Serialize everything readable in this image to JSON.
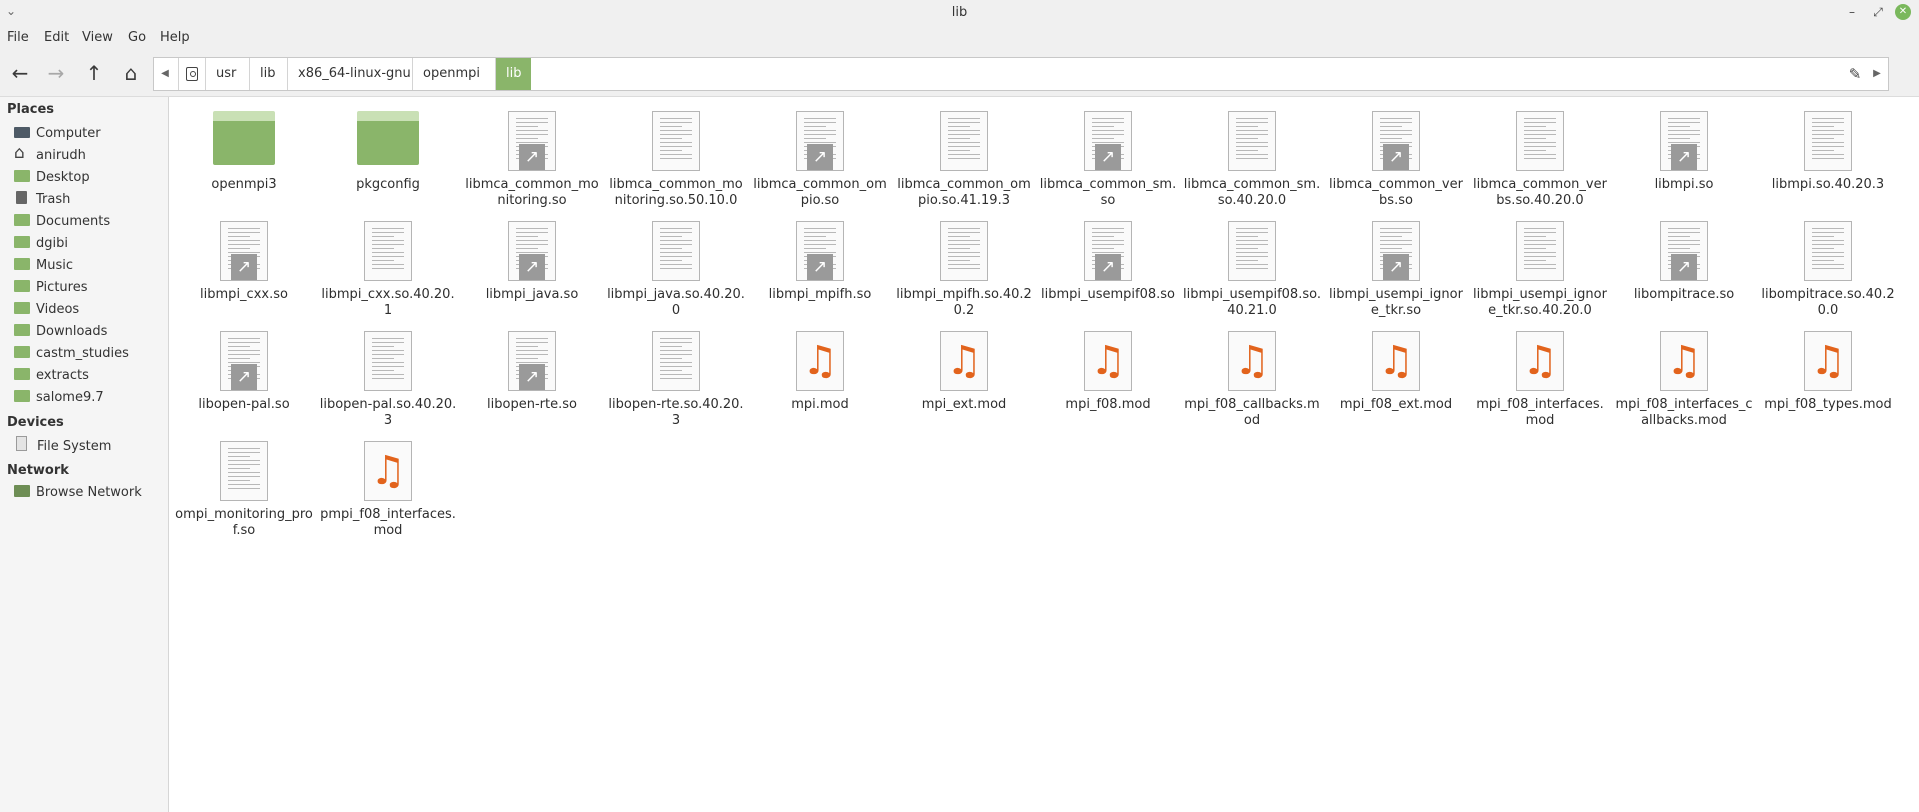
{
  "window": {
    "title": "lib"
  },
  "menu": [
    "File",
    "Edit",
    "View",
    "Go",
    "Help"
  ],
  "path": [
    "usr",
    "lib",
    "x86_64-linux-gnu",
    "openmpi",
    "lib"
  ],
  "sidebar": {
    "places_label": "Places",
    "places": [
      {
        "label": "Computer",
        "icon": "computer-icon"
      },
      {
        "label": "anirudh",
        "icon": "home-icon"
      },
      {
        "label": "Desktop",
        "icon": "folder-icon"
      },
      {
        "label": "Trash",
        "icon": "trash-icon"
      },
      {
        "label": "Documents",
        "icon": "folder-icon"
      },
      {
        "label": "dgibi",
        "icon": "folder-icon"
      },
      {
        "label": "Music",
        "icon": "folder-icon"
      },
      {
        "label": "Pictures",
        "icon": "folder-icon"
      },
      {
        "label": "Videos",
        "icon": "folder-icon"
      },
      {
        "label": "Downloads",
        "icon": "folder-icon"
      },
      {
        "label": "castm_studies",
        "icon": "folder-icon"
      },
      {
        "label": "extracts",
        "icon": "folder-icon"
      },
      {
        "label": "salome9.7",
        "icon": "folder-icon"
      }
    ],
    "devices_label": "Devices",
    "devices": [
      {
        "label": "File System",
        "icon": "drive-icon"
      }
    ],
    "network_label": "Network",
    "network": [
      {
        "label": "Browse Network",
        "icon": "network-icon"
      }
    ]
  },
  "files": [
    {
      "name": "openmpi3",
      "type": "folder"
    },
    {
      "name": "pkgconfig",
      "type": "folder"
    },
    {
      "name": "libmca_common_monitoring.so",
      "type": "doc",
      "link": true
    },
    {
      "name": "libmca_common_monitoring.so.50.10.0",
      "type": "doc",
      "link": false
    },
    {
      "name": "libmca_common_ompio.so",
      "type": "doc",
      "link": true
    },
    {
      "name": "libmca_common_ompio.so.41.19.3",
      "type": "doc",
      "link": false
    },
    {
      "name": "libmca_common_sm.so",
      "type": "doc",
      "link": true
    },
    {
      "name": "libmca_common_sm.so.40.20.0",
      "type": "doc",
      "link": false
    },
    {
      "name": "libmca_common_verbs.so",
      "type": "doc",
      "link": true
    },
    {
      "name": "libmca_common_verbs.so.40.20.0",
      "type": "doc",
      "link": false
    },
    {
      "name": "libmpi.so",
      "type": "doc",
      "link": true
    },
    {
      "name": "libmpi.so.40.20.3",
      "type": "doc",
      "link": false
    },
    {
      "name": "libmpi_cxx.so",
      "type": "doc",
      "link": true
    },
    {
      "name": "libmpi_cxx.so.40.20.1",
      "type": "doc",
      "link": false
    },
    {
      "name": "libmpi_java.so",
      "type": "doc",
      "link": true
    },
    {
      "name": "libmpi_java.so.40.20.0",
      "type": "doc",
      "link": false
    },
    {
      "name": "libmpi_mpifh.so",
      "type": "doc",
      "link": true
    },
    {
      "name": "libmpi_mpifh.so.40.20.2",
      "type": "doc",
      "link": false
    },
    {
      "name": "libmpi_usempif08.so",
      "type": "doc",
      "link": true
    },
    {
      "name": "libmpi_usempif08.so.40.21.0",
      "type": "doc",
      "link": false
    },
    {
      "name": "libmpi_usempi_ignore_tkr.so",
      "type": "doc",
      "link": true
    },
    {
      "name": "libmpi_usempi_ignore_tkr.so.40.20.0",
      "type": "doc",
      "link": false
    },
    {
      "name": "libompitrace.so",
      "type": "doc",
      "link": true
    },
    {
      "name": "libompitrace.so.40.20.0",
      "type": "doc",
      "link": false
    },
    {
      "name": "libopen-pal.so",
      "type": "doc",
      "link": true
    },
    {
      "name": "libopen-pal.so.40.20.3",
      "type": "doc",
      "link": false
    },
    {
      "name": "libopen-rte.so",
      "type": "doc",
      "link": true
    },
    {
      "name": "libopen-rte.so.40.20.3",
      "type": "doc",
      "link": false
    },
    {
      "name": "mpi.mod",
      "type": "music"
    },
    {
      "name": "mpi_ext.mod",
      "type": "music"
    },
    {
      "name": "mpi_f08.mod",
      "type": "music"
    },
    {
      "name": "mpi_f08_callbacks.mod",
      "type": "music"
    },
    {
      "name": "mpi_f08_ext.mod",
      "type": "music"
    },
    {
      "name": "mpi_f08_interfaces.mod",
      "type": "music"
    },
    {
      "name": "mpi_f08_interfaces_callbacks.mod",
      "type": "music"
    },
    {
      "name": "mpi_f08_types.mod",
      "type": "music"
    },
    {
      "name": "ompi_monitoring_prof.so",
      "type": "doc",
      "link": false
    },
    {
      "name": "pmpi_f08_interfaces.mod",
      "type": "music"
    }
  ]
}
